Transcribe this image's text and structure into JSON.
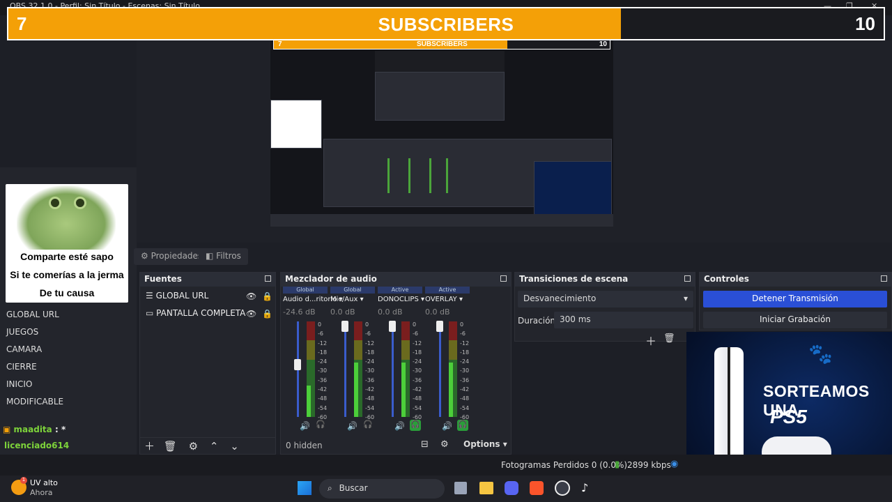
{
  "window": {
    "title": "OBS 32.1.0 - Perfil: Sin Título - Escenas: Sin Título"
  },
  "subscribers": {
    "current": "7",
    "label": "SUBSCRIBERS",
    "goal": "10",
    "progress": 0.7,
    "color_fill": "#f4a007"
  },
  "nested_preview": {
    "current": "7",
    "label": "SUBSCRIBERS",
    "goal": "10"
  },
  "frog_card": {
    "line1": "Comparte esté sapo",
    "line2": "Si te comerías a la jerma",
    "line3": "De tu causa"
  },
  "scenes": [
    "GLOBAL URL",
    "JUEGOS",
    "CAMARA",
    "CIERRE",
    "INICIO",
    "MODIFICABLE"
  ],
  "chat": {
    "user1": "maadita",
    "msg1": ": *",
    "user2": "licenciado614"
  },
  "tabs": {
    "properties": "Propiedades",
    "filters": "Filtros"
  },
  "sources": {
    "title": "Fuentes",
    "items": [
      {
        "label": "GLOBAL URL",
        "icon": "list-icon"
      },
      {
        "label": "PANTALLA COMPLETA",
        "icon": "monitor-icon"
      }
    ]
  },
  "mixer": {
    "title": "Mezclador de audio",
    "channels": [
      {
        "tag": "Global",
        "name": "Audio d...ritorio",
        "db": "-24.6 dB",
        "level": 0.55
      },
      {
        "tag": "Global",
        "name": "Mic/Aux",
        "db": "0.0 dB",
        "level": 0.95
      },
      {
        "tag": "Active",
        "name": "DONOCLIPS",
        "db": "0.0 dB",
        "level": 0.95
      },
      {
        "tag": "Active",
        "name": "OVERLAY",
        "db": "0.0 dB",
        "level": 0.95
      }
    ],
    "ticks": [
      "0",
      "-6",
      "-12",
      "-18",
      "-24",
      "-30",
      "-36",
      "-42",
      "-48",
      "-54",
      "-60"
    ],
    "hidden": "0 hidden",
    "options": "Options"
  },
  "transitions": {
    "title": "Transiciones de escena",
    "selected": "Desvanecimiento",
    "duration_label": "Duración",
    "duration_value": "300 ms"
  },
  "controls": {
    "title": "Controles",
    "stop_stream": "Detener Transmisión",
    "start_record": "Iniciar Grabación",
    "stop_color": "#2a4fd6"
  },
  "status": {
    "dropped": "Fotogramas Perdidos 0 (0.0%)",
    "bitrate": "2899 kbps"
  },
  "taskbar": {
    "notif_title": "UV alto",
    "notif_sub": "Ahora",
    "search": "Buscar",
    "badge": "1"
  },
  "promo": {
    "line1": "SORTEAMOS UNA",
    "line2": "PS5"
  }
}
